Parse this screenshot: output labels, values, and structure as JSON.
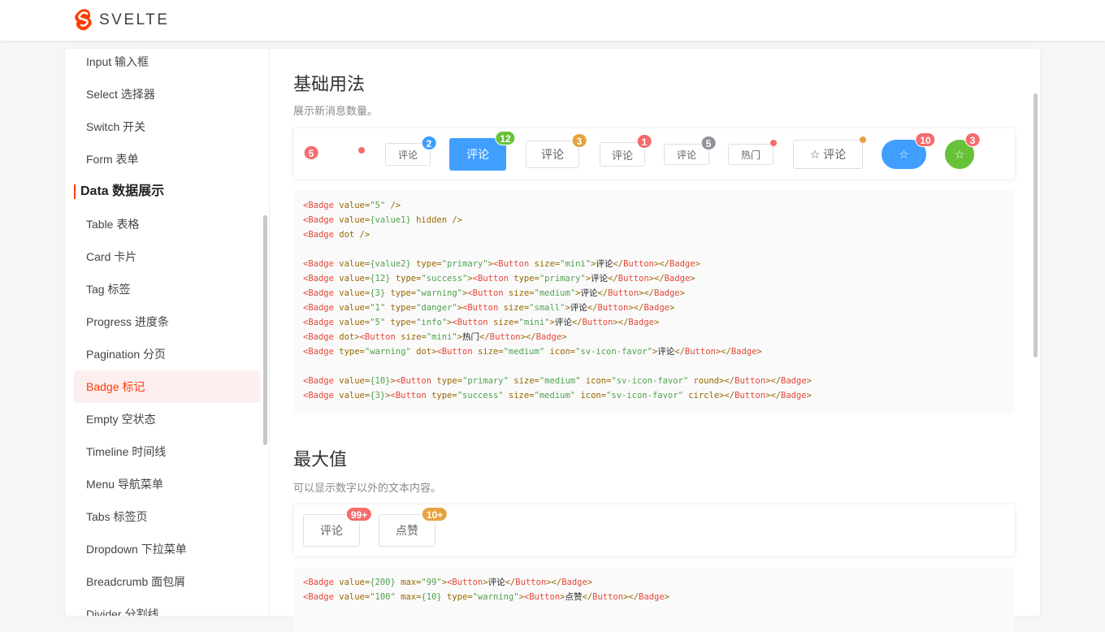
{
  "header": {
    "logo_text": "SVELTE"
  },
  "sidebar": {
    "items_top": [
      "Input 输入框",
      "Select 选择器",
      "Switch 开关",
      "Form 表单"
    ],
    "group": "Data 数据展示",
    "items": [
      "Table 表格",
      "Card 卡片",
      "Tag 标签",
      "Progress 进度条",
      "Pagination 分页",
      "Badge 标记",
      "Empty 空状态",
      "Timeline 时间线",
      "Menu 导航菜单",
      "Tabs 标签页",
      "Dropdown 下拉菜单",
      "Breadcrumb 面包屑",
      "Divider 分割线"
    ],
    "active": "Badge 标记"
  },
  "colors": {
    "primary": "#409eff",
    "success": "#67c23a",
    "warning": "#e6a23c",
    "danger": "#f56c6c",
    "info": "#909399",
    "accent": "#ff3e00"
  },
  "section1": {
    "title": "基础用法",
    "desc": "展示新消息数量。",
    "badges": {
      "standalone": "5",
      "b1": "2",
      "b2": "12",
      "b3": "3",
      "b4": "1",
      "b5": "5",
      "b8": "10",
      "b9": "3"
    },
    "buttons": {
      "b1": "评论",
      "b2": "评论",
      "b3": "评论",
      "b4": "评论",
      "b5": "评论",
      "b6": "热门",
      "b7": "评论"
    },
    "code": [
      [
        [
          "tag",
          "<Badge "
        ],
        [
          "attr",
          "value="
        ],
        [
          "str",
          "\"5\""
        ],
        [
          "attr",
          " />"
        ]
      ],
      [
        [
          "tag",
          "<Badge "
        ],
        [
          "attr",
          "value="
        ],
        [
          "str",
          "{value1}"
        ],
        [
          "attr",
          " hidden />"
        ]
      ],
      [
        [
          "tag",
          "<Badge "
        ],
        [
          "attr",
          "dot />"
        ]
      ],
      [],
      [
        [
          "tag",
          "<Badge "
        ],
        [
          "attr",
          "value="
        ],
        [
          "str",
          "{value2}"
        ],
        [
          "attr",
          " type="
        ],
        [
          "str",
          "\"primary\""
        ],
        [
          "attr",
          ">"
        ],
        [
          "tag",
          "<Button "
        ],
        [
          "attr",
          "size="
        ],
        [
          "str",
          "\"mini\""
        ],
        [
          "attr",
          ">"
        ],
        [
          "txt",
          "评论"
        ],
        [
          "attr",
          "</"
        ],
        [
          "tag",
          "Button"
        ],
        [
          "attr",
          "></"
        ],
        [
          "tag",
          "Badge"
        ],
        [
          "attr",
          ">"
        ]
      ],
      [
        [
          "tag",
          "<Badge "
        ],
        [
          "attr",
          "value="
        ],
        [
          "str",
          "{12}"
        ],
        [
          "attr",
          " type="
        ],
        [
          "str",
          "\"success\""
        ],
        [
          "attr",
          ">"
        ],
        [
          "tag",
          "<Button "
        ],
        [
          "attr",
          "type="
        ],
        [
          "str",
          "\"primary\""
        ],
        [
          "attr",
          ">"
        ],
        [
          "txt",
          "评论"
        ],
        [
          "attr",
          "</"
        ],
        [
          "tag",
          "Button"
        ],
        [
          "attr",
          "></"
        ],
        [
          "tag",
          "Badge"
        ],
        [
          "attr",
          ">"
        ]
      ],
      [
        [
          "tag",
          "<Badge "
        ],
        [
          "attr",
          "value="
        ],
        [
          "str",
          "{3}"
        ],
        [
          "attr",
          " type="
        ],
        [
          "str",
          "\"warning\""
        ],
        [
          "attr",
          ">"
        ],
        [
          "tag",
          "<Button "
        ],
        [
          "attr",
          "size="
        ],
        [
          "str",
          "\"medium\""
        ],
        [
          "attr",
          ">"
        ],
        [
          "txt",
          "评论"
        ],
        [
          "attr",
          "</"
        ],
        [
          "tag",
          "Button"
        ],
        [
          "attr",
          "></"
        ],
        [
          "tag",
          "Badge"
        ],
        [
          "attr",
          ">"
        ]
      ],
      [
        [
          "tag",
          "<Badge "
        ],
        [
          "attr",
          "value="
        ],
        [
          "str",
          "\"1\""
        ],
        [
          "attr",
          " type="
        ],
        [
          "str",
          "\"danger\""
        ],
        [
          "attr",
          ">"
        ],
        [
          "tag",
          "<Button "
        ],
        [
          "attr",
          "size="
        ],
        [
          "str",
          "\"small\""
        ],
        [
          "attr",
          ">"
        ],
        [
          "txt",
          "评论"
        ],
        [
          "attr",
          "</"
        ],
        [
          "tag",
          "Button"
        ],
        [
          "attr",
          "></"
        ],
        [
          "tag",
          "Badge"
        ],
        [
          "attr",
          ">"
        ]
      ],
      [
        [
          "tag",
          "<Badge "
        ],
        [
          "attr",
          "value="
        ],
        [
          "str",
          "\"5\""
        ],
        [
          "attr",
          " type="
        ],
        [
          "str",
          "\"info\""
        ],
        [
          "attr",
          ">"
        ],
        [
          "tag",
          "<Button "
        ],
        [
          "attr",
          "size="
        ],
        [
          "str",
          "\"mini\""
        ],
        [
          "attr",
          ">"
        ],
        [
          "txt",
          "评论"
        ],
        [
          "attr",
          "</"
        ],
        [
          "tag",
          "Button"
        ],
        [
          "attr",
          "></"
        ],
        [
          "tag",
          "Badge"
        ],
        [
          "attr",
          ">"
        ]
      ],
      [
        [
          "tag",
          "<Badge "
        ],
        [
          "attr",
          "dot>"
        ],
        [
          "tag",
          "<Button "
        ],
        [
          "attr",
          "size="
        ],
        [
          "str",
          "\"mini\""
        ],
        [
          "attr",
          ">"
        ],
        [
          "txt",
          "热门"
        ],
        [
          "attr",
          "</"
        ],
        [
          "tag",
          "Button"
        ],
        [
          "attr",
          "></"
        ],
        [
          "tag",
          "Badge"
        ],
        [
          "attr",
          ">"
        ]
      ],
      [
        [
          "tag",
          "<Badge "
        ],
        [
          "attr",
          "type="
        ],
        [
          "str",
          "\"warning\""
        ],
        [
          "attr",
          " dot>"
        ],
        [
          "tag",
          "<Button "
        ],
        [
          "attr",
          "size="
        ],
        [
          "str",
          "\"medium\""
        ],
        [
          "attr",
          " icon="
        ],
        [
          "str",
          "\"sv-icon-favor\""
        ],
        [
          "attr",
          ">"
        ],
        [
          "txt",
          "评论"
        ],
        [
          "attr",
          "</"
        ],
        [
          "tag",
          "Button"
        ],
        [
          "attr",
          "></"
        ],
        [
          "tag",
          "Badge"
        ],
        [
          "attr",
          ">"
        ]
      ],
      [],
      [
        [
          "tag",
          "<Badge "
        ],
        [
          "attr",
          "value="
        ],
        [
          "str",
          "{10}"
        ],
        [
          "attr",
          ">"
        ],
        [
          "tag",
          "<Button "
        ],
        [
          "attr",
          "type="
        ],
        [
          "str",
          "\"primary\""
        ],
        [
          "attr",
          " size="
        ],
        [
          "str",
          "\"medium\""
        ],
        [
          "attr",
          " icon="
        ],
        [
          "str",
          "\"sv-icon-favor\""
        ],
        [
          "attr",
          " round>"
        ],
        [
          "attr",
          "</"
        ],
        [
          "tag",
          "Button"
        ],
        [
          "attr",
          "></"
        ],
        [
          "tag",
          "Badge"
        ],
        [
          "attr",
          ">"
        ]
      ],
      [
        [
          "tag",
          "<Badge "
        ],
        [
          "attr",
          "value="
        ],
        [
          "str",
          "{3}"
        ],
        [
          "attr",
          ">"
        ],
        [
          "tag",
          "<Button "
        ],
        [
          "attr",
          "type="
        ],
        [
          "str",
          "\"success\""
        ],
        [
          "attr",
          " size="
        ],
        [
          "str",
          "\"medium\""
        ],
        [
          "attr",
          " icon="
        ],
        [
          "str",
          "\"sv-icon-favor\""
        ],
        [
          "attr",
          " circle>"
        ],
        [
          "attr",
          "</"
        ],
        [
          "tag",
          "Button"
        ],
        [
          "attr",
          "></"
        ],
        [
          "tag",
          "Badge"
        ],
        [
          "attr",
          ">"
        ]
      ]
    ]
  },
  "section2": {
    "title": "最大值",
    "desc": "可以显示数字以外的文本内容。",
    "buttons": {
      "b1": "评论",
      "b2": "点赞"
    },
    "badges": {
      "b1": "99+",
      "b2": "10+"
    },
    "code": [
      [
        [
          "tag",
          "<Badge "
        ],
        [
          "attr",
          "value="
        ],
        [
          "str",
          "{200}"
        ],
        [
          "attr",
          " max="
        ],
        [
          "str",
          "\"99\""
        ],
        [
          "attr",
          ">"
        ],
        [
          "tag",
          "<Button"
        ],
        [
          "attr",
          ">"
        ],
        [
          "txt",
          "评论"
        ],
        [
          "attr",
          "</"
        ],
        [
          "tag",
          "Button"
        ],
        [
          "attr",
          "></"
        ],
        [
          "tag",
          "Badge"
        ],
        [
          "attr",
          ">"
        ]
      ],
      [
        [
          "tag",
          "<Badge "
        ],
        [
          "attr",
          "value="
        ],
        [
          "str",
          "\"100\""
        ],
        [
          "attr",
          " max="
        ],
        [
          "str",
          "{10}"
        ],
        [
          "attr",
          " type="
        ],
        [
          "str",
          "\"warning\""
        ],
        [
          "attr",
          ">"
        ],
        [
          "tag",
          "<Button"
        ],
        [
          "attr",
          ">"
        ],
        [
          "txt",
          "点赞"
        ],
        [
          "attr",
          "</"
        ],
        [
          "tag",
          "Button"
        ],
        [
          "attr",
          "></"
        ],
        [
          "tag",
          "Badge"
        ],
        [
          "attr",
          ">"
        ]
      ]
    ]
  }
}
